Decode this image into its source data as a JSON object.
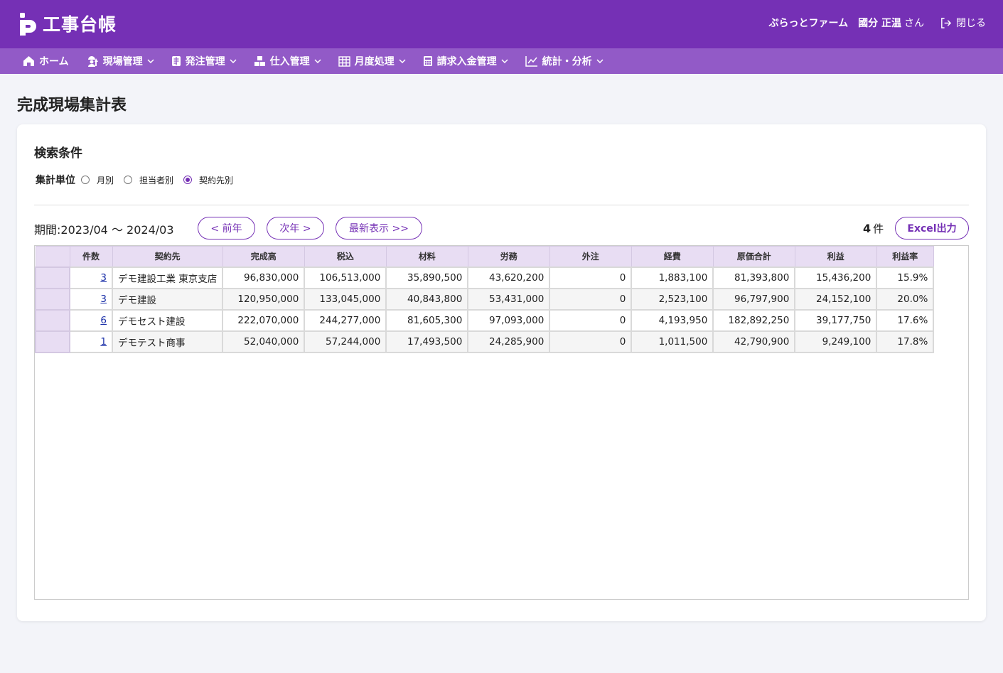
{
  "header": {
    "app_title": "工事台帳",
    "company": "ぷらっとファーム",
    "user_name": "國分 正温",
    "user_suffix": "さん",
    "close_label": "閉じる"
  },
  "nav": {
    "items": [
      {
        "label": "ホーム",
        "icon": "home-icon"
      },
      {
        "label": "現場管理",
        "icon": "worker-icon"
      },
      {
        "label": "発注管理",
        "icon": "document-icon"
      },
      {
        "label": "仕入管理",
        "icon": "boxes-icon"
      },
      {
        "label": "月度処理",
        "icon": "calendar-icon"
      },
      {
        "label": "請求入金管理",
        "icon": "calculator-icon"
      },
      {
        "label": "統計・分析",
        "icon": "chart-line-icon"
      }
    ]
  },
  "page": {
    "title": "完成現場集計表"
  },
  "search": {
    "title": "検索条件",
    "unit_label": "集計単位",
    "options": [
      "月別",
      "担当者別",
      "契約先別"
    ],
    "selected": "契約先別"
  },
  "toolbar": {
    "period": "期間:2023/04 ～ 2024/03",
    "prev_label": "< 前年",
    "next_label": "次年 >",
    "latest_label": "最新表示 >>",
    "count_value": "4",
    "count_unit": "件",
    "excel_label": "Excel出力"
  },
  "table": {
    "headers": [
      "件数",
      "契約先",
      "完成高",
      "税込",
      "材料",
      "労務",
      "外注",
      "経費",
      "原価合計",
      "利益",
      "利益率"
    ],
    "rows": [
      [
        "3",
        "デモ建設工業 東京支店",
        "96,830,000",
        "106,513,000",
        "35,890,500",
        "43,620,200",
        "0",
        "1,883,100",
        "81,393,800",
        "15,436,200",
        "15.9%"
      ],
      [
        "3",
        "デモ建設",
        "120,950,000",
        "133,045,000",
        "40,843,800",
        "53,431,000",
        "0",
        "2,523,100",
        "96,797,900",
        "24,152,100",
        "20.0%"
      ],
      [
        "6",
        "デモセスト建設",
        "222,070,000",
        "244,277,000",
        "81,605,300",
        "97,093,000",
        "0",
        "4,193,950",
        "182,892,250",
        "39,177,750",
        "17.6%"
      ],
      [
        "1",
        "デモテスト商事",
        "52,040,000",
        "57,244,000",
        "17,493,500",
        "24,285,900",
        "0",
        "1,011,500",
        "42,790,900",
        "9,249,100",
        "17.8%"
      ]
    ]
  }
}
